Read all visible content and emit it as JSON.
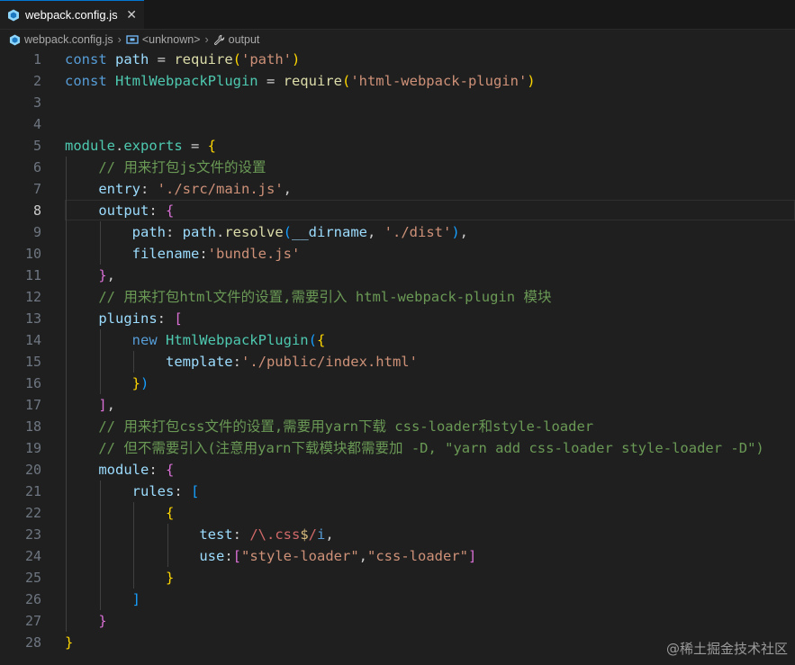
{
  "tab": {
    "label": "webpack.config.js",
    "close": "✕",
    "icon": "webpack-file-icon"
  },
  "breadcrumb": {
    "file": "webpack.config.js",
    "symbol": "<unknown>",
    "property": "output"
  },
  "lines": [
    {
      "n": "1",
      "tokens": [
        [
          "k",
          "const "
        ],
        [
          "v",
          "path"
        ],
        [
          "p",
          " = "
        ],
        [
          "f",
          "require"
        ],
        [
          "b1",
          "("
        ],
        [
          "s",
          "'path'"
        ],
        [
          "b1",
          ")"
        ]
      ]
    },
    {
      "n": "2",
      "tokens": [
        [
          "k",
          "const "
        ],
        [
          "t",
          "HtmlWebpackPlugin"
        ],
        [
          "p",
          " = "
        ],
        [
          "f",
          "require"
        ],
        [
          "b1",
          "("
        ],
        [
          "s",
          "'html-webpack-plugin'"
        ],
        [
          "b1",
          ")"
        ]
      ]
    },
    {
      "n": "3",
      "tokens": []
    },
    {
      "n": "4",
      "tokens": []
    },
    {
      "n": "5",
      "tokens": [
        [
          "t",
          "module"
        ],
        [
          "p",
          "."
        ],
        [
          "t",
          "exports"
        ],
        [
          "p",
          " = "
        ],
        [
          "b1",
          "{"
        ]
      ]
    },
    {
      "n": "6",
      "tokens": [
        [
          "p",
          "    "
        ],
        [
          "c",
          "// 用来打包js文件的设置"
        ]
      ]
    },
    {
      "n": "7",
      "tokens": [
        [
          "p",
          "    "
        ],
        [
          "v",
          "entry"
        ],
        [
          "p",
          ": "
        ],
        [
          "s",
          "'./src/main.js'"
        ],
        [
          "p",
          ","
        ]
      ]
    },
    {
      "n": "8",
      "tokens": [
        [
          "p",
          "    "
        ],
        [
          "v",
          "output"
        ],
        [
          "p",
          ": "
        ],
        [
          "b2",
          "{"
        ]
      ],
      "current": true
    },
    {
      "n": "9",
      "tokens": [
        [
          "p",
          "        "
        ],
        [
          "v",
          "path"
        ],
        [
          "p",
          ": "
        ],
        [
          "v",
          "path"
        ],
        [
          "p",
          "."
        ],
        [
          "f",
          "resolve"
        ],
        [
          "b3",
          "("
        ],
        [
          "v",
          "__dirname"
        ],
        [
          "p",
          ", "
        ],
        [
          "s",
          "'./dist'"
        ],
        [
          "b3",
          ")"
        ],
        [
          "p",
          ","
        ]
      ]
    },
    {
      "n": "10",
      "tokens": [
        [
          "p",
          "        "
        ],
        [
          "v",
          "filename"
        ],
        [
          "p",
          ":"
        ],
        [
          "s",
          "'bundle.js'"
        ]
      ]
    },
    {
      "n": "11",
      "tokens": [
        [
          "p",
          "    "
        ],
        [
          "b2",
          "}"
        ],
        [
          "p",
          ","
        ]
      ]
    },
    {
      "n": "12",
      "tokens": [
        [
          "p",
          "    "
        ],
        [
          "c",
          "// 用来打包html文件的设置,需要引入 html-webpack-plugin 模块"
        ]
      ]
    },
    {
      "n": "13",
      "tokens": [
        [
          "p",
          "    "
        ],
        [
          "v",
          "plugins"
        ],
        [
          "p",
          ": "
        ],
        [
          "b2",
          "["
        ]
      ]
    },
    {
      "n": "14",
      "tokens": [
        [
          "p",
          "        "
        ],
        [
          "k",
          "new "
        ],
        [
          "t",
          "HtmlWebpackPlugin"
        ],
        [
          "b3",
          "("
        ],
        [
          "b1",
          "{"
        ]
      ]
    },
    {
      "n": "15",
      "tokens": [
        [
          "p",
          "            "
        ],
        [
          "v",
          "template"
        ],
        [
          "p",
          ":"
        ],
        [
          "s",
          "'./public/index.html'"
        ]
      ]
    },
    {
      "n": "16",
      "tokens": [
        [
          "p",
          "        "
        ],
        [
          "b1",
          "}"
        ],
        [
          "b3",
          ")"
        ]
      ]
    },
    {
      "n": "17",
      "tokens": [
        [
          "p",
          "    "
        ],
        [
          "b2",
          "]"
        ],
        [
          "p",
          ","
        ]
      ]
    },
    {
      "n": "18",
      "tokens": [
        [
          "p",
          "    "
        ],
        [
          "c",
          "// 用来打包css文件的设置,需要用yarn下载 css-loader和style-loader"
        ]
      ]
    },
    {
      "n": "19",
      "tokens": [
        [
          "p",
          "    "
        ],
        [
          "c",
          "// 但不需要引入(注意用yarn下载模块都需要加 -D, \"yarn add css-loader style-loader -D\")"
        ]
      ]
    },
    {
      "n": "20",
      "tokens": [
        [
          "p",
          "    "
        ],
        [
          "v",
          "module"
        ],
        [
          "p",
          ": "
        ],
        [
          "b2",
          "{"
        ]
      ]
    },
    {
      "n": "21",
      "tokens": [
        [
          "p",
          "        "
        ],
        [
          "v",
          "rules"
        ],
        [
          "p",
          ": "
        ],
        [
          "b3",
          "["
        ]
      ]
    },
    {
      "n": "22",
      "tokens": [
        [
          "p",
          "            "
        ],
        [
          "b1",
          "{"
        ]
      ]
    },
    {
      "n": "23",
      "tokens": [
        [
          "p",
          "                "
        ],
        [
          "v",
          "test"
        ],
        [
          "p",
          ": "
        ],
        [
          "r",
          "/\\."
        ],
        [
          "r",
          "css"
        ],
        [
          "e",
          "$"
        ],
        [
          "r",
          "/"
        ],
        [
          "k",
          "i"
        ],
        [
          "p",
          ","
        ]
      ]
    },
    {
      "n": "24",
      "tokens": [
        [
          "p",
          "                "
        ],
        [
          "v",
          "use"
        ],
        [
          "p",
          ":"
        ],
        [
          "b2",
          "["
        ],
        [
          "s",
          "\"style-loader\""
        ],
        [
          "p",
          ","
        ],
        [
          "s",
          "\"css-loader\""
        ],
        [
          "b2",
          "]"
        ]
      ]
    },
    {
      "n": "25",
      "tokens": [
        [
          "p",
          "            "
        ],
        [
          "b1",
          "}"
        ]
      ]
    },
    {
      "n": "26",
      "tokens": [
        [
          "p",
          "        "
        ],
        [
          "b3",
          "]"
        ]
      ]
    },
    {
      "n": "27",
      "tokens": [
        [
          "p",
          "    "
        ],
        [
          "b2",
          "}"
        ]
      ]
    },
    {
      "n": "28",
      "tokens": [
        [
          "b1",
          "}"
        ]
      ]
    }
  ],
  "watermark": "@稀土掘金技术社区",
  "colors": {
    "background": "#1f1f1f",
    "keyword": "#569cd6",
    "string": "#ce9178",
    "comment": "#6a9955",
    "function": "#dcdcaa",
    "variable": "#9cdcfe",
    "type": "#4ec9b0"
  }
}
